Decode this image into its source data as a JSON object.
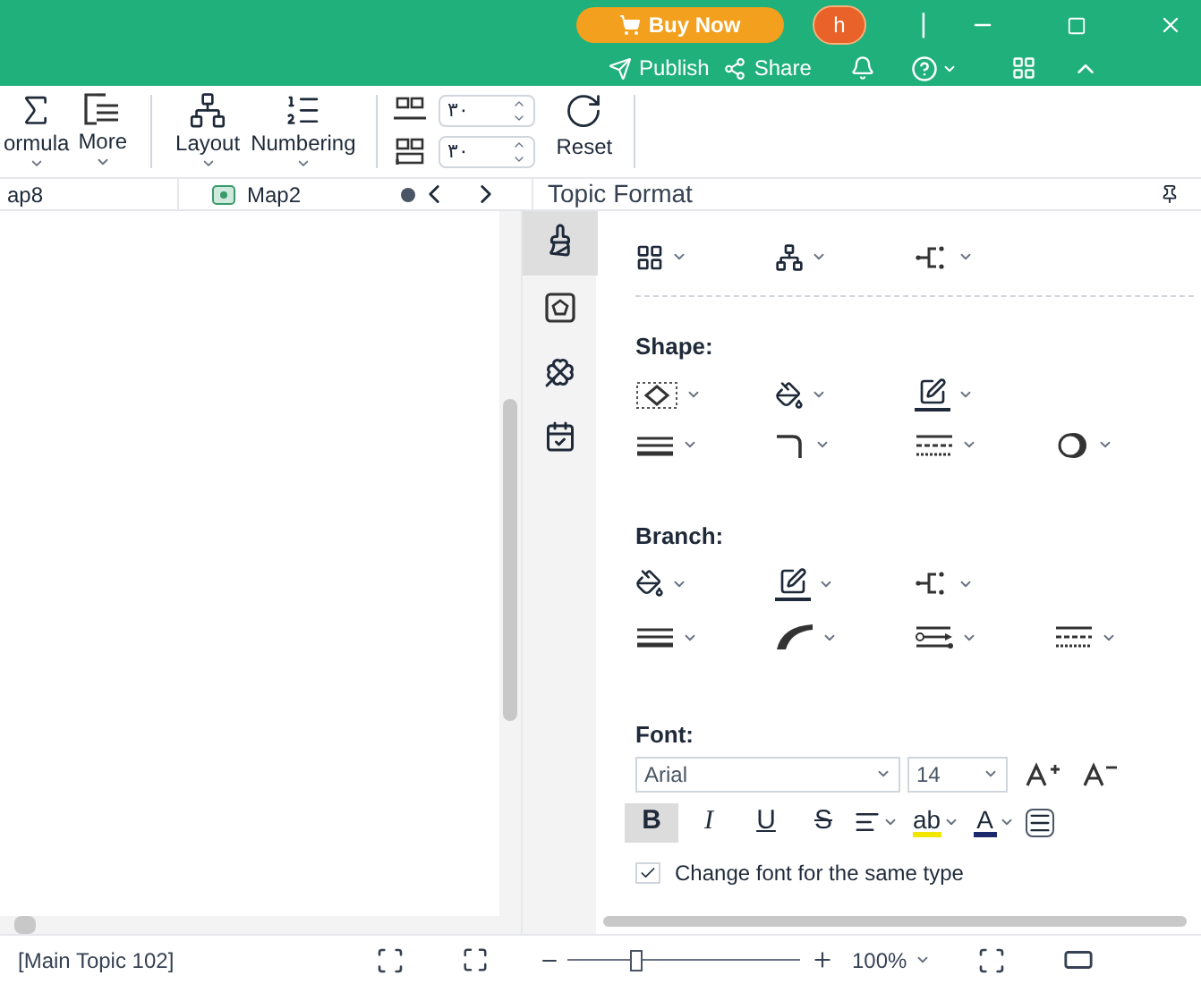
{
  "header": {
    "buy_button": "Buy Now",
    "avatar": "h",
    "divider": "|",
    "publish": "Publish",
    "share": "Share"
  },
  "ribbon": {
    "items": [
      {
        "label": "ormula",
        "kind": "formula"
      },
      {
        "label": "More",
        "kind": "more"
      },
      {
        "label": "Layout",
        "kind": "layout"
      },
      {
        "label": "Numbering",
        "kind": "numbering"
      }
    ],
    "spinners": [
      {
        "value": "٣٠"
      },
      {
        "value": "٣٠"
      }
    ],
    "reset": "Reset"
  },
  "tabs": [
    {
      "label": "ap8",
      "has_icon": false
    },
    {
      "label": "Map2",
      "has_icon": true
    }
  ],
  "panel": {
    "title": "Topic Format",
    "side_tabs": [
      {
        "kind": "style",
        "selected": true
      },
      {
        "kind": "shape",
        "selected": false
      },
      {
        "kind": "clover",
        "selected": false
      },
      {
        "kind": "task",
        "selected": false
      }
    ],
    "shape_label": "Shape:",
    "branch_label": "Branch:",
    "font_label": "Font:",
    "font": {
      "family": "Arial",
      "size": "14"
    },
    "format_buttons": [
      {
        "label": "B",
        "kind": "bold",
        "selected": true
      },
      {
        "label": "I",
        "kind": "italic",
        "selected": false
      },
      {
        "label": "U",
        "kind": "underline",
        "selected": false
      },
      {
        "label": "S",
        "kind": "strike",
        "selected": false
      }
    ],
    "highlight": "ab",
    "font_color": "A",
    "same_type": {
      "label": "Change font for the same type",
      "checked": true
    }
  },
  "status_bar": {
    "topic": "[Main Topic 102]",
    "level": 0.3,
    "zoom": "100%"
  }
}
